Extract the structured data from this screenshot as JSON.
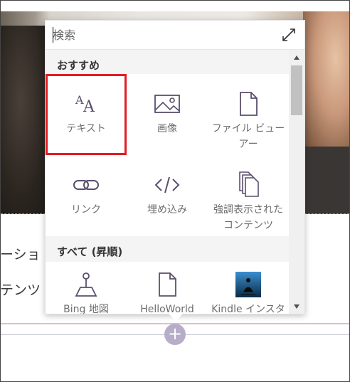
{
  "background": {
    "partial_text_1": "ーショ",
    "partial_text_2": "テンツ",
    "add_button": "+"
  },
  "picker": {
    "search": {
      "placeholder": "検索",
      "value": ""
    },
    "sections": [
      {
        "title": "おすすめ",
        "items": [
          {
            "label": "テキスト",
            "icon": "text-icon",
            "selected": true
          },
          {
            "label": "画像",
            "icon": "image-icon"
          },
          {
            "label": "ファイル ビューアー",
            "icon": "file-viewer-icon"
          },
          {
            "label": "リンク",
            "icon": "link-icon"
          },
          {
            "label": "埋め込み",
            "icon": "embed-icon"
          },
          {
            "label": "強調表示されたコンテンツ",
            "icon": "highlighted-content-icon"
          }
        ]
      },
      {
        "title": "すべて (昇順)",
        "items": [
          {
            "label": "Bing 地図",
            "icon": "map-pin-icon"
          },
          {
            "label": "HelloWorld",
            "icon": "document-icon"
          },
          {
            "label": "Kindle インスタント プレビュー",
            "icon": "kindle-icon"
          }
        ]
      }
    ]
  },
  "colors": {
    "selection_outline": "#e31c23",
    "icon_stroke": "#5a4f6e",
    "add_button_bg": "#b6aec8"
  }
}
